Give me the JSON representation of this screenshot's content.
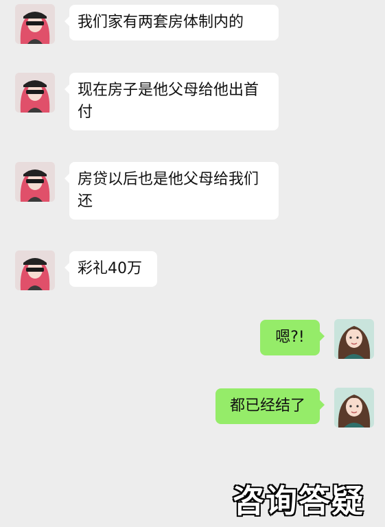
{
  "messages": [
    {
      "side": "in",
      "text": "我们家有两套房体制内的"
    },
    {
      "side": "in",
      "text": "现在房子是他父母给他出首付"
    },
    {
      "side": "in",
      "text": "房贷以后也是他父母给我们还"
    },
    {
      "side": "in",
      "text": "彩礼40万"
    },
    {
      "side": "out",
      "text": "嗯?!"
    },
    {
      "side": "out",
      "text": "都已经结了"
    }
  ],
  "caption": "咨询答疑",
  "colors": {
    "background": "#ededed",
    "incoming_bubble": "#ffffff",
    "outgoing_bubble": "#95ec69"
  },
  "icons": {
    "incoming_avatar": "avatar-pink-hair-blindfold",
    "outgoing_avatar": "avatar-illustrated-girl"
  }
}
